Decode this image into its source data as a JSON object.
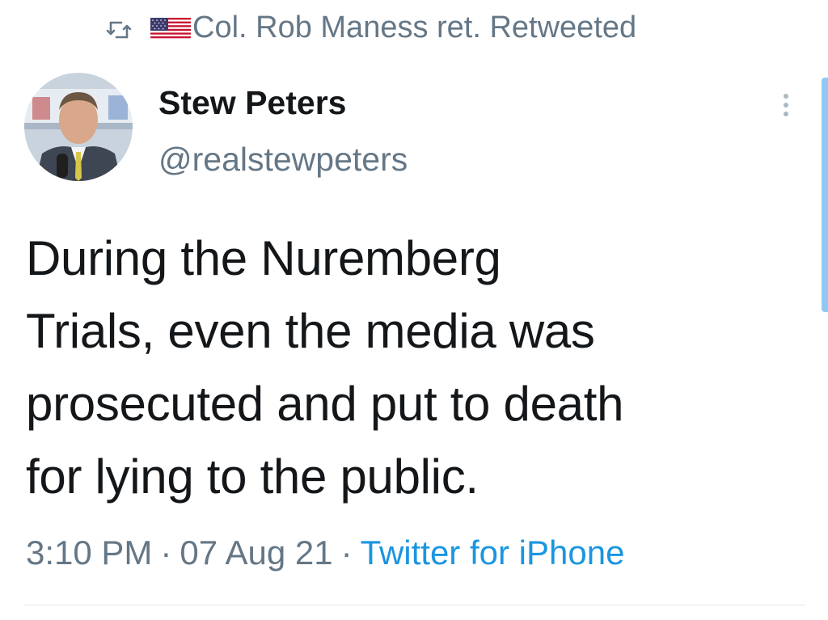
{
  "retweet": {
    "icon": "retweet-icon",
    "flag": "us-flag-icon",
    "text": "Col. Rob Maness ret. Retweeted"
  },
  "author": {
    "display_name": "Stew Peters",
    "handle": "@realstewpeters",
    "avatar": "avatar-photo"
  },
  "tweet": {
    "lines": [
      "During the Nuremberg",
      "Trials, even the media was",
      "prosecuted and put to death",
      "for lying to the public."
    ],
    "time": "3:10 PM",
    "date": "07 Aug 21",
    "separator": "·",
    "source": "Twitter for iPhone"
  },
  "colors": {
    "text": "#14171a",
    "secondary": "#657786",
    "link": "#1b95e0"
  }
}
